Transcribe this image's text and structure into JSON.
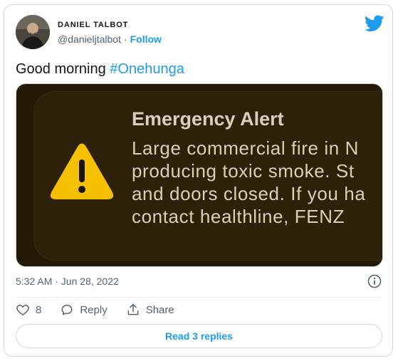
{
  "author": {
    "name": "DANIEL TALBOT",
    "handle": "@danieljtalbot",
    "separator": "·",
    "follow_label": "Follow"
  },
  "tweet": {
    "text_prefix": "Good morning ",
    "hashtag": "#Onehunga"
  },
  "media": {
    "alert_title": "Emergency Alert",
    "alert_lines": [
      "Large commercial fire in N",
      "producing toxic smoke. St",
      "and doors closed. If you ha",
      "contact healthline, FENZ"
    ]
  },
  "meta": {
    "timestamp": "5:32 AM · Jun 28, 2022"
  },
  "actions": {
    "like_count": "8",
    "reply_label": "Reply",
    "share_label": "Share"
  },
  "footer": {
    "read_replies_label": "Read 3 replies"
  },
  "colors": {
    "accent": "#1d9bf0",
    "text": "#0f1419",
    "muted": "#536471",
    "alert_bg": "#2d2209",
    "warning_yellow": "#f5c000"
  }
}
